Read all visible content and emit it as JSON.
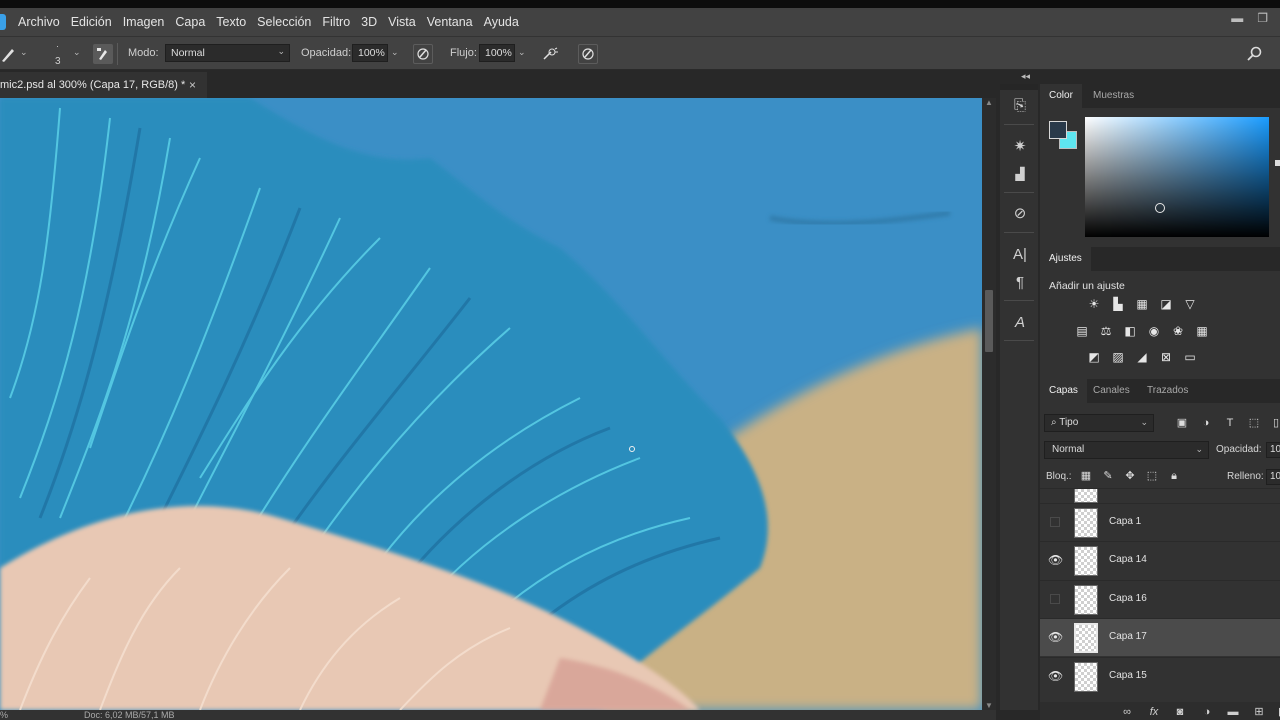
{
  "menu": {
    "items": [
      "Archivo",
      "Edición",
      "Imagen",
      "Capa",
      "Texto",
      "Selección",
      "Filtro",
      "3D",
      "Vista",
      "Ventana",
      "Ayuda"
    ]
  },
  "window_controls": {
    "minimize": "▬",
    "restore": "❐"
  },
  "options_bar": {
    "brush_size": "3",
    "mode_label": "Modo:",
    "mode_value": "Normal",
    "opacity_label": "Opacidad:",
    "opacity_value": "100%",
    "flow_label": "Flujo:",
    "flow_value": "100%"
  },
  "document_tab": {
    "title": "mic2.psd al 300% (Capa 17, RGB/8) *",
    "close": "×"
  },
  "status_bar": {
    "zoom": "%",
    "doc_info": "Doc: 6,02 MB/57,1 MB"
  },
  "color_panel": {
    "tabs": [
      "Color",
      "Muestras"
    ],
    "foreground": "#2a3a4a",
    "background": "#5ee6f0",
    "hue": "#1a9cff"
  },
  "adjustments_panel": {
    "title": "Ajustes",
    "subtitle": "Añadir un ajuste"
  },
  "layers_panel": {
    "tabs": [
      "Capas",
      "Canales",
      "Trazados"
    ],
    "filter_label": "Tipo",
    "blend_mode": "Normal",
    "opacity_label": "Opacidad:",
    "opacity_value": "10",
    "lock_label": "Bloq.:",
    "fill_label": "Relleno:",
    "fill_value": "10",
    "layers": [
      {
        "name": "Capa 1",
        "visible": false,
        "selected": false
      },
      {
        "name": "Capa 14",
        "visible": true,
        "selected": false
      },
      {
        "name": "Capa 16",
        "visible": false,
        "selected": false
      },
      {
        "name": "Capa 17",
        "visible": true,
        "selected": true
      },
      {
        "name": "Capa 15",
        "visible": true,
        "selected": false
      }
    ]
  },
  "colors": {
    "canvas_sky": "#3b8fc6",
    "canvas_hair": "#2f9bc4",
    "canvas_skin": "#e8c8b4",
    "canvas_sand": "#c9b185"
  }
}
